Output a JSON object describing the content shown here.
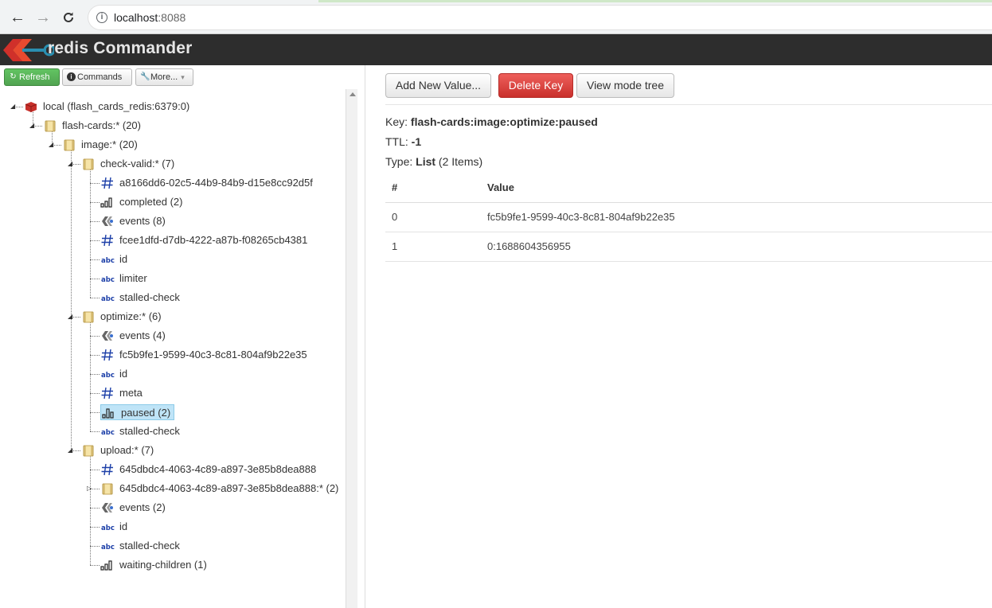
{
  "browser": {
    "url_host": "localhost",
    "url_port": ":8088"
  },
  "header": {
    "title": "redis Commander"
  },
  "toolbar": {
    "refresh_label": "Refresh",
    "commands_label": "Commands",
    "more_label": "More..."
  },
  "tree": [
    {
      "label": "local (flash_cards_redis:6379:0)",
      "icon": "redis-server-icon"
    },
    {
      "label": "flash-cards:* (20)",
      "icon": "folder-icon"
    },
    {
      "label": "image:* (20)",
      "icon": "folder-icon"
    },
    {
      "label": "check-valid:* (7)",
      "icon": "folder-icon"
    },
    {
      "label": "a8166dd6-02c5-44b9-84b9-d15e8cc92d5f",
      "icon": "hash-icon"
    },
    {
      "label": "completed (2)",
      "icon": "zset-icon"
    },
    {
      "label": "events (8)",
      "icon": "stream-icon"
    },
    {
      "label": "fcee1dfd-d7db-4222-a87b-f08265cb4381",
      "icon": "hash-icon"
    },
    {
      "label": "id",
      "icon": "string-icon"
    },
    {
      "label": "limiter",
      "icon": "string-icon"
    },
    {
      "label": "stalled-check",
      "icon": "string-icon"
    },
    {
      "label": "optimize:* (6)",
      "icon": "folder-icon"
    },
    {
      "label": "events (4)",
      "icon": "stream-icon"
    },
    {
      "label": "fc5b9fe1-9599-40c3-8c81-804af9b22e35",
      "icon": "hash-icon"
    },
    {
      "label": "id",
      "icon": "string-icon"
    },
    {
      "label": "meta",
      "icon": "hash-icon"
    },
    {
      "label": "paused (2)",
      "icon": "list-icon"
    },
    {
      "label": "stalled-check",
      "icon": "string-icon"
    },
    {
      "label": "upload:* (7)",
      "icon": "folder-icon"
    },
    {
      "label": "645dbdc4-4063-4c89-a897-3e85b8dea888",
      "icon": "hash-icon"
    },
    {
      "label": "645dbdc4-4063-4c89-a897-3e85b8dea888:* (2)",
      "icon": "folder-icon"
    },
    {
      "label": "events (2)",
      "icon": "stream-icon"
    },
    {
      "label": "id",
      "icon": "string-icon"
    },
    {
      "label": "stalled-check",
      "icon": "string-icon"
    },
    {
      "label": "waiting-children (1)",
      "icon": "zset-icon"
    }
  ],
  "main": {
    "add_value_label": "Add New Value...",
    "delete_key_label": "Delete Key",
    "view_mode_label": "View mode tree",
    "key_prefix": "Key:",
    "key_value": "flash-cards:image:optimize:paused",
    "ttl_prefix": "TTL:",
    "ttl_value": "-1",
    "type_prefix": "Type:",
    "type_value": "List",
    "type_count": "(2 Items)",
    "table": {
      "col_index": "#",
      "col_value": "Value",
      "rows": [
        {
          "index": "0",
          "value": "fc5b9fe1-9599-40c3-8c81-804af9b22e35"
        },
        {
          "index": "1",
          "value": "0:1688604356955"
        }
      ]
    }
  },
  "colors": {
    "header_bg": "#2d2d2d",
    "danger": "#d9534f",
    "success": "#5cb85c",
    "selected": "#bfe4f7"
  }
}
